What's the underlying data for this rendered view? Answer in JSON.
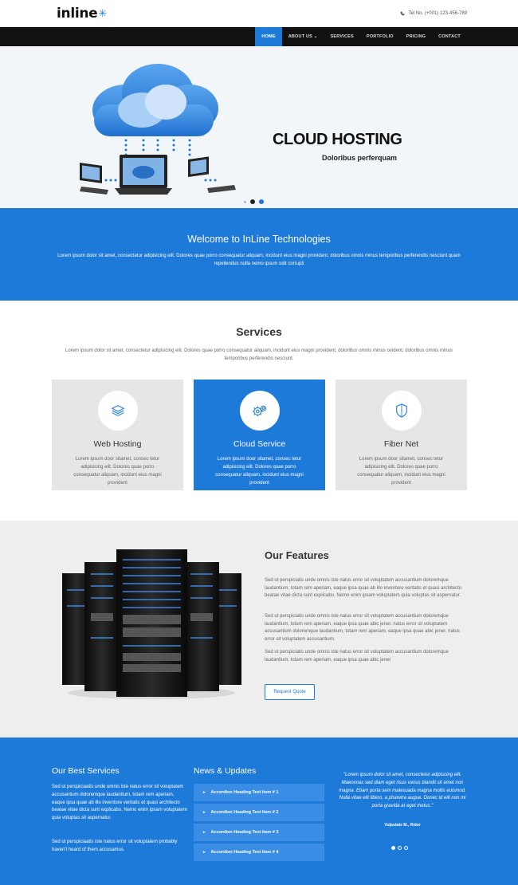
{
  "header": {
    "logo": "inline",
    "phone": "Tel No. (+001) 123-456-789"
  },
  "nav": {
    "items": [
      {
        "label": "HOME"
      },
      {
        "label": "ABOUT US ⌄"
      },
      {
        "label": "SERVICES"
      },
      {
        "label": "PORTFOLIO"
      },
      {
        "label": "PRICING"
      },
      {
        "label": "CONTACT"
      }
    ]
  },
  "hero": {
    "title": "CLOUD HOSTING",
    "subtitle": "Doloribus perferquam"
  },
  "welcome": {
    "title": "Welcome to InLine Technologies",
    "text": "Lorem ipsum dolor sit amet, consectetur adipisicing elit. Dolores quae porro consequatur aliquam, incidunt eius magni provident, doloribus omnis minus temporibus perferendis nesciunt quam repellendus nulla nemo ipsum odit corrupti"
  },
  "services": {
    "title": "Services",
    "intro": "Lorem ipsum dolor sit amet, consectetur adipisicing elit. Dolores quae porro consequatur aliquam, incidunt eius magni provident, doloribus omnis minus ovident, doloribus omnis minus temporibus perferendis nesciunt.",
    "cards": [
      {
        "title": "Web Hosting",
        "text": "Lorem ipsum door sitamet, consec tetur adipisicing elit. Dolores quae porro consequatur aliquam, incidunt eius magni provident"
      },
      {
        "title": "Cloud Service",
        "text": "Lorem ipsum door sitamet, consec tetur adipisicing elit. Dolores quae porro consequatur aliquam, incidunt eius magni provident"
      },
      {
        "title": "Fiber Net",
        "text": "Lorem ipsum door sitamet, consec tetur adipisicing elit. Dolores quae porro consequatur aliquam, incidunt eius magni provident"
      }
    ]
  },
  "features": {
    "title": "Our Features",
    "paragraphs": [
      "Sed ut perspiciatis unde omnis iste natus error sit voluptatem accusantium doloremque laudantium, totam rem aperiam, eaque ipsa quae ab illo inventore veritatis et quasi architecto beatae vitae dicta sunt explicabo. Nemo enim ipsam voluptatem quia voluptas sit aspernatur.",
      "Sed ut perspiciatis unde omnis iste natus error sit voluptatem accusantium doloremque laudantium, totam rem aperiam, eaque ipsa quae abic jener. natus error sit voluptatem accusantium doloremque laudantium, totam rem aperiam, eaque ipsa quae abic jener. natus error sit voluptatem accusantium.",
      "Sed ut perspiciatis unde omnis iste natus error sit voluptatem accusantium doloremque laudantium, totam rem aperiam, eaque ipsa quae abic jener"
    ],
    "button": "Request Quote"
  },
  "footer": {
    "best_title": "Our Best Services",
    "best_p1": "Sed ut perspiciaatis unde omnis iste natus error sit voluptatem accusantium doloremque laudantium, totam rem aperiam, eaque ipsa quae ab illo inventore veritatis et quasi architecto beatae vitae dicta sunt explicabo. Nemo enim ipsam voluptatem quia voluptas sit aspernatur.",
    "best_p2": "Sed ut perspiciaatis iste natus error sit voluptatem probably haven't heard of them accusamus.",
    "news_title": "News & Updates",
    "accordion": [
      {
        "label": "Accordion Heading Text Item # 1"
      },
      {
        "label": "Accordion Heading Text Item # 2"
      },
      {
        "label": "Accordion Heading Text Item # 3"
      },
      {
        "label": "Accordion Heading Text Item # 4"
      }
    ],
    "testimonial": "\"Lorem ipsum dolor sit amet, consectetur adipiscing elit. Maecenas sed diam eget risus varius blandit sit amet non magna. Etiam porta sem malesuada magna mollis euismod. Nulla vitae elit libero, a pharetra augue. Donec id elit non mi porta gravida at eget metus.\"",
    "author": "Vulputate M., Ridor"
  },
  "colors": {
    "accent": "#1e7ad9",
    "dark": "#111111"
  }
}
